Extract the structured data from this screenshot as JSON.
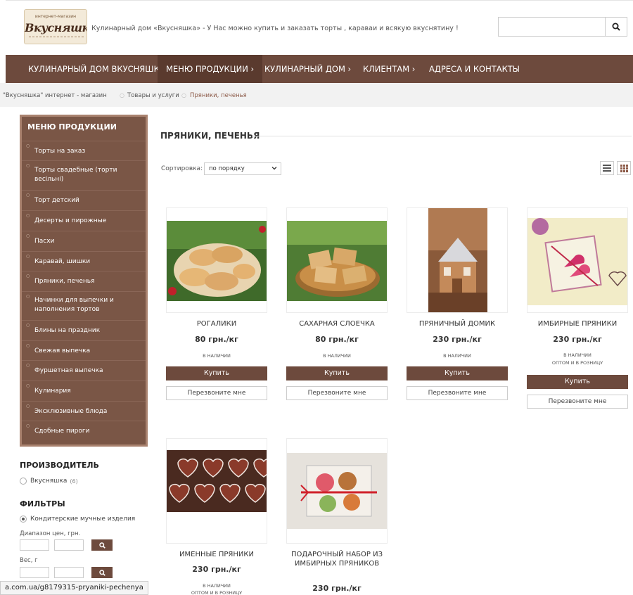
{
  "header": {
    "logo_small": "интернет-магазин",
    "logo_main": "Вкусняшка",
    "tagline": "Кулинарный дом «Вкусняшка» - У Нас можно купить и заказать торты , караваи и всякую вкуснятину !",
    "search_placeholder": ""
  },
  "nav": {
    "items": [
      {
        "label": "КУЛИНАРНЫЙ ДОМ ВКУСНЯШКА"
      },
      {
        "label": "МЕНЮ ПРОДУКЦИИ  ›"
      },
      {
        "label": "КУЛИНАРНЫЙ ДОМ  ›"
      },
      {
        "label": "КЛИЕНТАМ  ›"
      },
      {
        "label": "АДРЕСА И КОНТАКТЫ"
      }
    ]
  },
  "breadcrumb": [
    "\"Вкусняшка\" интернет - магазин",
    "Товары и услуги",
    "Пряники, печенья"
  ],
  "sidebar": {
    "title": "МЕНЮ ПРОДУКЦИИ",
    "items": [
      {
        "label": "Торты на заказ"
      },
      {
        "label": "Торты свадебные (торти весільні)"
      },
      {
        "label": "Торт детский"
      },
      {
        "label": "Десерты и пирожные"
      },
      {
        "label": "Пасхи"
      },
      {
        "label": "Каравай, шишки"
      },
      {
        "label": "Пряники, печенья"
      },
      {
        "label": "Начинки для выпечки и наполнения тортов"
      },
      {
        "label": "Блины на праздник"
      },
      {
        "label": "Свежая выпечка"
      },
      {
        "label": "Фуршетная выпечка"
      },
      {
        "label": "Кулинария"
      },
      {
        "label": "Эксклюзивные блюда"
      },
      {
        "label": "Сдобные пироги"
      }
    ]
  },
  "filters": {
    "producer_title": "ПРОИЗВОДИТЕЛЬ",
    "producer": "Вкусняшка",
    "producer_count": "(6)",
    "filters_title": "ФИЛЬТРЫ",
    "category": "Кондитерские мучные изделия",
    "price_label": "Диапазон цен, грн.",
    "weight_label": "Вес, г"
  },
  "main": {
    "title": "ПРЯНИКИ, ПЕЧЕНЬЯ",
    "sort_label": "Сортировка:",
    "sort_value": "по порядку"
  },
  "products": [
    {
      "name": "РОГАЛИКИ",
      "price": "80 грн./кг",
      "stock": "В НАЛИЧИИ",
      "stock2": "",
      "buy": "Купить",
      "call": "Перезвоните мне"
    },
    {
      "name": "САХАРНАЯ СЛОЕЧКА",
      "price": "80 грн./кг",
      "stock": "В НАЛИЧИИ",
      "stock2": "",
      "buy": "Купить",
      "call": "Перезвоните мне"
    },
    {
      "name": "ПРЯНИЧНЫЙ ДОМИК",
      "price": "230 грн./кг",
      "stock": "В НАЛИЧИИ",
      "stock2": "",
      "buy": "Купить",
      "call": "Перезвоните мне"
    },
    {
      "name": "ИМБИРНЫЕ ПРЯНИКИ",
      "price": "230 грн./кг",
      "stock": "В НАЛИЧИИ",
      "stock2": "ОПТОМ И В РОЗНИЦУ",
      "buy": "Купить",
      "call": "Перезвоните мне"
    },
    {
      "name": "ИМЕННЫЕ ПРЯНИКИ",
      "price": "230 грн./кг",
      "stock": "В НАЛИЧИИ",
      "stock2": "ОПТОМ И В РОЗНИЦУ"
    },
    {
      "name": "ПОДАРОЧНЫЙ НАБОР ИЗ ИМБИРНЫХ ПРЯНИКОВ",
      "price": "230 грн./кг"
    }
  ],
  "status_url": "a.com.ua/g8179315-pryaniki-pechenya",
  "colors": {
    "brand": "#6d4a3d",
    "brand_dark": "#5a3a2e",
    "accent": "#8c5a48"
  }
}
